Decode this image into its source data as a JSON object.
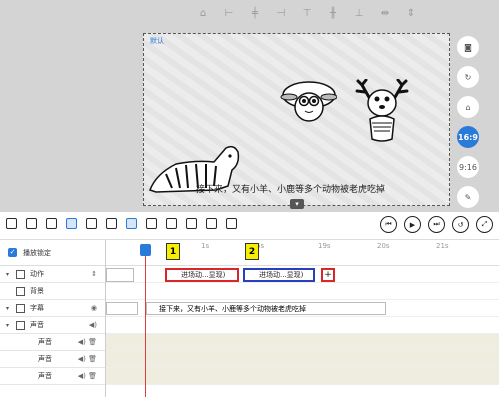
{
  "canvas": {
    "default_label": "默认",
    "subtitle": "接下来，又有小羊、小鹿等多个动物被老虎吃掉"
  },
  "right_buttons": [
    "camera",
    "refresh",
    "lock",
    "16:9",
    "9:16",
    "edit"
  ],
  "tracks": {
    "lock_label": "播放锁定",
    "rows": [
      {
        "label": "动作"
      },
      {
        "label": "背景"
      },
      {
        "label": "字幕"
      },
      {
        "label": "声音"
      },
      {
        "label": "声音"
      },
      {
        "label": "声音"
      },
      {
        "label": "声音"
      }
    ]
  },
  "ruler": {
    "ticks": [
      "1s",
      "5s",
      "19s",
      "20s",
      "21s"
    ]
  },
  "clips": {
    "clip1": "进场动...显现)",
    "clip2": "进场动...显现)",
    "badge1": "1",
    "badge2": "2",
    "add": "+",
    "subtitle_clip": "接下来，又有小羊、小鹿等多个动物被老虎吃掉"
  }
}
